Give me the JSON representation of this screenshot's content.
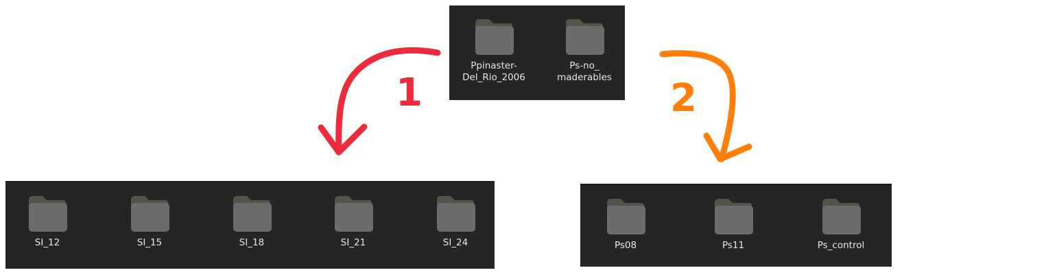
{
  "colors": {
    "panel_bg": "#252525",
    "folder_tab": "#54554a",
    "folder_body": "#6b6b6b",
    "label_text": "#e6e6e6",
    "arrow_1": "#ee2b3c",
    "arrow_2": "#ff7f0a"
  },
  "source_folders": [
    {
      "label": "Ppinaster-\nDel_Rio_2006",
      "icon": "folder-icon"
    },
    {
      "label": "Ps-no_\nmaderables",
      "icon": "folder-icon"
    }
  ],
  "step_1": {
    "number": "1",
    "folders": [
      {
        "label": "SI_12",
        "icon": "folder-icon"
      },
      {
        "label": "SI_15",
        "icon": "folder-icon"
      },
      {
        "label": "SI_18",
        "icon": "folder-icon"
      },
      {
        "label": "SI_21",
        "icon": "folder-icon"
      },
      {
        "label": "SI_24",
        "icon": "folder-icon"
      }
    ]
  },
  "step_2": {
    "number": "2",
    "folders": [
      {
        "label": "Ps08",
        "icon": "folder-icon"
      },
      {
        "label": "Ps11",
        "icon": "folder-icon"
      },
      {
        "label": "Ps_control",
        "icon": "folder-icon"
      }
    ]
  }
}
